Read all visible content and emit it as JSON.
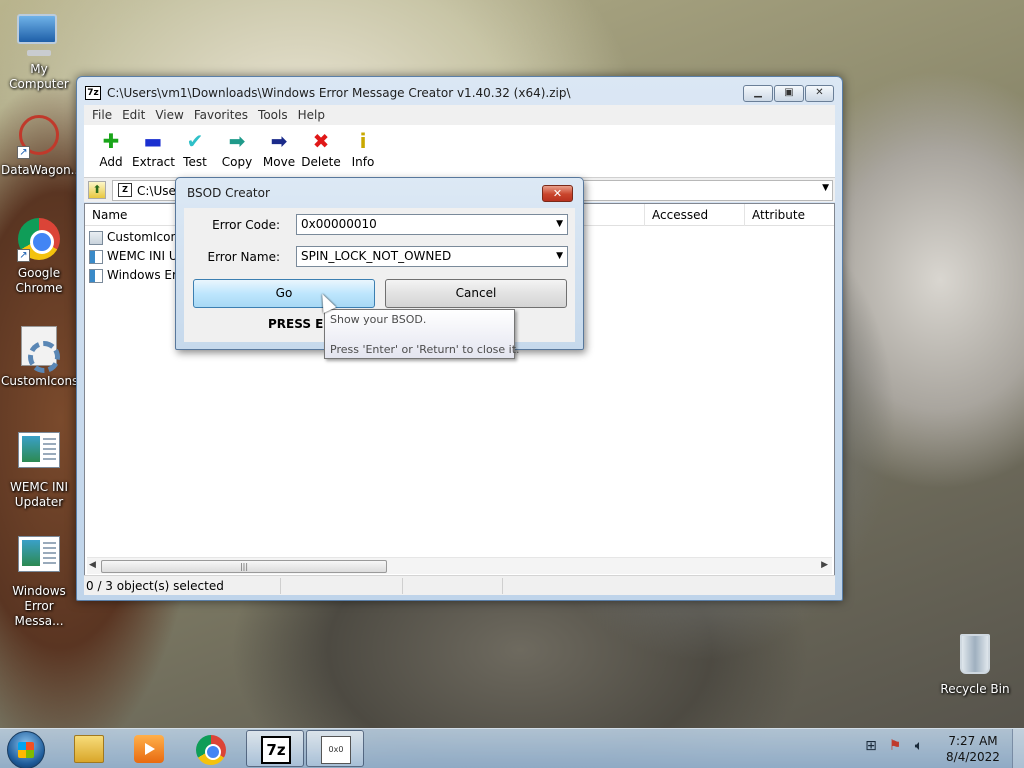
{
  "desktop": {
    "icons": [
      {
        "label": "My Computer"
      },
      {
        "label": "DataWagon..."
      },
      {
        "label": "Google Chrome"
      },
      {
        "label": "CustomIcons"
      },
      {
        "label": "WEMC INI Updater"
      },
      {
        "label": "Windows Error Messa..."
      },
      {
        "label": "Recycle Bin"
      }
    ]
  },
  "main_window": {
    "title": "C:\\Users\\vm1\\Downloads\\Windows Error Message Creator v1.40.32 (x64).zip\\",
    "app_icon_text": "7z",
    "menu": [
      "File",
      "Edit",
      "View",
      "Favorites",
      "Tools",
      "Help"
    ],
    "toolbar": [
      {
        "label": "Add",
        "icon": "plus-icon",
        "glyph": "✚"
      },
      {
        "label": "Extract",
        "icon": "minus-icon",
        "glyph": "▬"
      },
      {
        "label": "Test",
        "icon": "check-icon",
        "glyph": "✔"
      },
      {
        "label": "Copy",
        "icon": "copy-arrow-icon",
        "glyph": "➡"
      },
      {
        "label": "Move",
        "icon": "move-arrow-icon",
        "glyph": "➡"
      },
      {
        "label": "Delete",
        "icon": "delete-x-icon",
        "glyph": "✖"
      },
      {
        "label": "Info",
        "icon": "info-icon",
        "glyph": "i"
      }
    ],
    "address": {
      "path": "C:\\Use"
    },
    "columns": {
      "name": "Name",
      "modified_fragment": "ed",
      "accessed": "Accessed",
      "attributes": "Attribute"
    },
    "files": [
      {
        "name": "CustomIcons"
      },
      {
        "name": "WEMC INI Up"
      },
      {
        "name": "Windows Err"
      }
    ],
    "status": "0 / 3 object(s) selected"
  },
  "dialog": {
    "title": "BSOD Creator",
    "close_glyph": "✕",
    "error_code_label": "Error Code:",
    "error_code_value": "0x00000010",
    "error_name_label": "Error Name:",
    "error_name_value": "SPIN_LOCK_NOT_OWNED",
    "go_label": "Go",
    "cancel_label": "Cancel",
    "press_text": "PRESS EN"
  },
  "tooltip": {
    "line1": "Show your BSOD.",
    "line2": "Press 'Enter' or 'Return' to close it."
  },
  "taskbar": {
    "sevenzip_text": "7z",
    "wemc_text": "0x0",
    "clock_time": "7:27 AM",
    "clock_date": "8/4/2022"
  }
}
